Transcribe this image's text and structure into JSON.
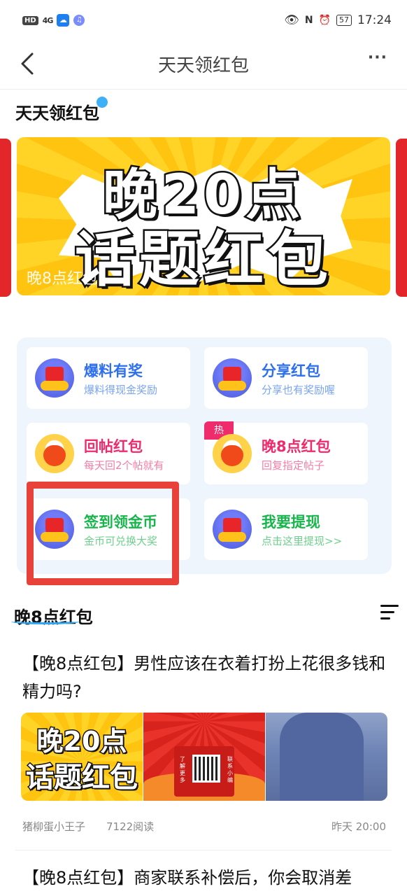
{
  "status_bar": {
    "hd": "HD",
    "signal": "4G",
    "app1": "☁",
    "app2": "♫",
    "battery": "57",
    "time": "17:24"
  },
  "nav": {
    "title": "天天领红包",
    "more": "···"
  },
  "section1": {
    "title": "天天领红包",
    "banner": {
      "line1": "晚20点",
      "line2": "话题红包",
      "caption": "晚8点红包"
    }
  },
  "grid": [
    {
      "title": "爆料有奖",
      "subtitle": "爆料得现金奖励",
      "icon": "red-envelope-coins-icon",
      "color": "blue"
    },
    {
      "title": "分享红包",
      "subtitle": "分享也有奖励喔",
      "icon": "red-envelope-coins-icon",
      "color": "blue"
    },
    {
      "title": "回帖红包",
      "subtitle": "每天回2个帖就有",
      "icon": "lucky-bag-icon",
      "color": "pink"
    },
    {
      "title": "晚8点红包",
      "subtitle": "回复指定帖子",
      "icon": "lucky-bag-icon",
      "color": "pink",
      "badge": "热"
    },
    {
      "title": "签到领金币",
      "subtitle": "金币可兑换大奖",
      "icon": "red-envelope-coins-icon",
      "color": "green"
    },
    {
      "title": "我要提现",
      "subtitle": "点击这里提现>>",
      "icon": "red-envelope-coins-icon",
      "color": "green"
    }
  ],
  "section2": {
    "title": "晚8点红包",
    "posts": [
      {
        "title": "【晚8点红包】男性应该在衣着打扮上花很多钱和精力吗?",
        "thumb1_line1": "晚20点",
        "thumb1_line2": "话题红包",
        "thumb2_left": "了解更多",
        "thumb2_right": "联系小编",
        "author": "猪柳蛋小王子",
        "reads": "7122阅读",
        "time": "昨天 20:00"
      },
      {
        "title": "【晚8点红包】商家联系补偿后，你会取消差"
      }
    ]
  },
  "colors": {
    "accent_blue": "#2d6ff1",
    "pink": "#ef2b6c",
    "green": "#17b64a",
    "highlight_red": "#e8413a"
  }
}
